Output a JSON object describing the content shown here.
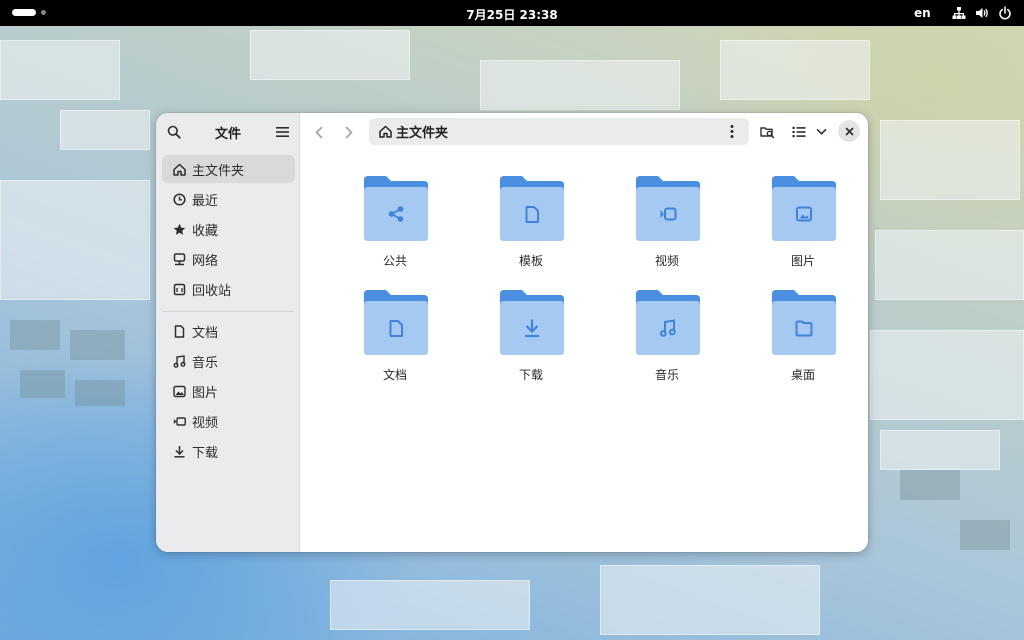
{
  "topbar": {
    "clock": "7月25日  23:38",
    "language": "en"
  },
  "sidebar": {
    "title": "文件",
    "places": [
      {
        "label": "主文件夹",
        "icon": "home-icon",
        "active": true
      },
      {
        "label": "最近",
        "icon": "clock-icon",
        "active": false
      },
      {
        "label": "收藏",
        "icon": "star-icon",
        "active": false
      },
      {
        "label": "网络",
        "icon": "network-icon",
        "active": false
      },
      {
        "label": "回收站",
        "icon": "trash-icon",
        "active": false
      }
    ],
    "bookmarks": [
      {
        "label": "文档",
        "icon": "document-icon"
      },
      {
        "label": "音乐",
        "icon": "music-icon"
      },
      {
        "label": "图片",
        "icon": "picture-icon"
      },
      {
        "label": "视频",
        "icon": "video-icon"
      },
      {
        "label": "下载",
        "icon": "download-icon"
      }
    ]
  },
  "pathbar": {
    "location": "主文件夹"
  },
  "folders": [
    {
      "label": "公共",
      "icon": "share-icon"
    },
    {
      "label": "模板",
      "icon": "template-icon"
    },
    {
      "label": "视频",
      "icon": "video-icon"
    },
    {
      "label": "图片",
      "icon": "picture-icon"
    },
    {
      "label": "文档",
      "icon": "document-icon"
    },
    {
      "label": "下载",
      "icon": "download-icon"
    },
    {
      "label": "音乐",
      "icon": "music-icon"
    },
    {
      "label": "桌面",
      "icon": "desktop-folder-icon"
    }
  ],
  "colors": {
    "folder_back": "#4a8fe0",
    "folder_front": "#a6c9f2",
    "folder_glyph": "#3f84da",
    "topbar": "#000000"
  }
}
